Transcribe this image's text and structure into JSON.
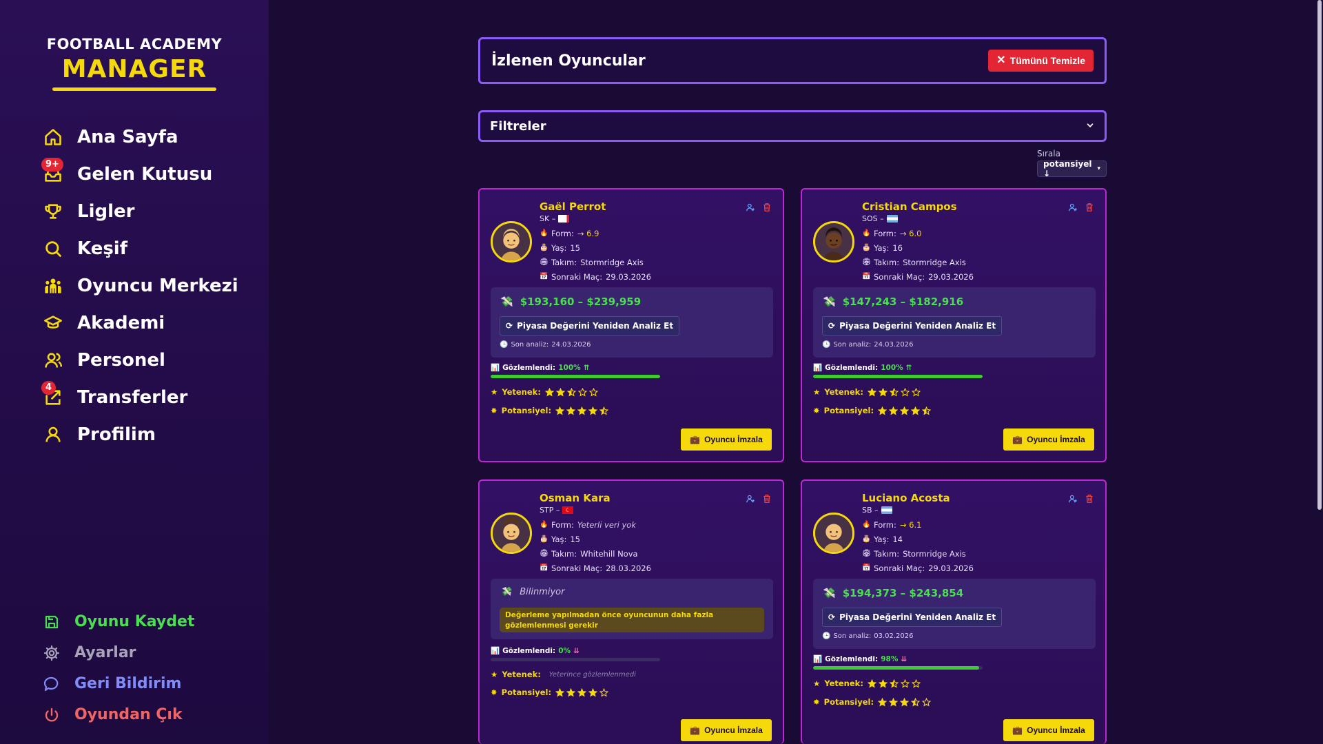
{
  "app": {
    "logo_top": "FOOTBALL ACADEMY",
    "logo_main": "MANAGER"
  },
  "nav": {
    "items": [
      {
        "label": "Ana Sayfa",
        "icon": "home-icon"
      },
      {
        "label": "Gelen Kutusu",
        "icon": "inbox-icon",
        "badge": "9+"
      },
      {
        "label": "Ligler",
        "icon": "trophy-icon"
      },
      {
        "label": "Keşif",
        "icon": "search-icon"
      },
      {
        "label": "Oyuncu Merkezi",
        "icon": "players-icon"
      },
      {
        "label": "Akademi",
        "icon": "graduation-cap-icon"
      },
      {
        "label": "Personel",
        "icon": "staff-icon"
      },
      {
        "label": "Transferler",
        "icon": "transfer-icon",
        "badge": "4"
      },
      {
        "label": "Profilim",
        "icon": "user-icon"
      }
    ],
    "bottom": [
      {
        "label": "Oyunu Kaydet",
        "icon": "save-icon",
        "color": "#4ade50"
      },
      {
        "label": "Ayarlar",
        "icon": "gear-icon",
        "color": "#a8a3b8"
      },
      {
        "label": "Geri Bildirim",
        "icon": "chat-icon",
        "color": "#818cf8"
      },
      {
        "label": "Oyundan Çık",
        "icon": "power-icon",
        "color": "#f06464"
      }
    ]
  },
  "header": {
    "title": "İzlenen Oyuncular",
    "clear_button": "Tümünü Temizle"
  },
  "filters": {
    "title": "Filtreler"
  },
  "sort": {
    "label": "Sırala",
    "value": "potansiyel ↓"
  },
  "labels": {
    "form": "Form:",
    "age": "Yaş:",
    "team": "Takım:",
    "next_match": "Sonraki Maç:",
    "reanalyze": "Piyasa Değerini Yeniden Analiz Et",
    "last_analysis": "Son analiz:",
    "observed": "Gözlemlendi:",
    "skill": "Yetenek:",
    "potential": "Potansiyel:",
    "sign": "Oyuncu İmzala"
  },
  "players": [
    {
      "name": "Gaël Perrot",
      "position": "SK –",
      "flag": "france",
      "form": "→ 6.9",
      "age": "15",
      "team": "Stormridge Axis",
      "next_match": "29.03.2026",
      "value_range": "$193,160 – $239,959",
      "last_analysis": "24.03.2026",
      "observed": "100%",
      "observed_trend": "up",
      "observed_fraction": 1.0,
      "skill": 2.5,
      "potential": 4.5,
      "skin": "#f2c27a"
    },
    {
      "name": "Cristian Campos",
      "position": "SOS –",
      "flag": "argentina",
      "form": "→ 6.0",
      "age": "16",
      "team": "Stormridge Axis",
      "next_match": "29.03.2026",
      "value_range": "$147,243 – $182,916",
      "last_analysis": "24.03.2026",
      "observed": "100%",
      "observed_trend": "up",
      "observed_fraction": 1.0,
      "skill": 2.5,
      "potential": 4.5,
      "skin": "#6b3f22"
    },
    {
      "name": "Osman Kara",
      "position": "STP –",
      "flag": "turkey",
      "form": "Yeterli veri yok",
      "age": "15",
      "team": "Whitehill Nova",
      "next_match": "28.03.2026",
      "value_unknown": "Bilinmiyor",
      "warning": "Değerleme yapılmadan önce oyuncunun daha fazla gözlemlenmesi gerekir",
      "observed": "0%",
      "observed_trend": "down",
      "observed_fraction": 0.0,
      "skill_text": "Yeterince gözlemlenmedi",
      "potential": 4,
      "skin": "#f2c27a"
    },
    {
      "name": "Luciano Acosta",
      "position": "SB –",
      "flag": "argentina",
      "form": "→ 6.1",
      "age": "14",
      "team": "Stormridge Axis",
      "next_match": "29.03.2026",
      "value_range": "$194,373 – $243,854",
      "last_analysis": "03.02.2026",
      "observed": "98%",
      "observed_trend": "down",
      "observed_fraction": 0.98,
      "skill": 2.5,
      "potential": 3.5,
      "skin": "#f2c27a"
    }
  ]
}
